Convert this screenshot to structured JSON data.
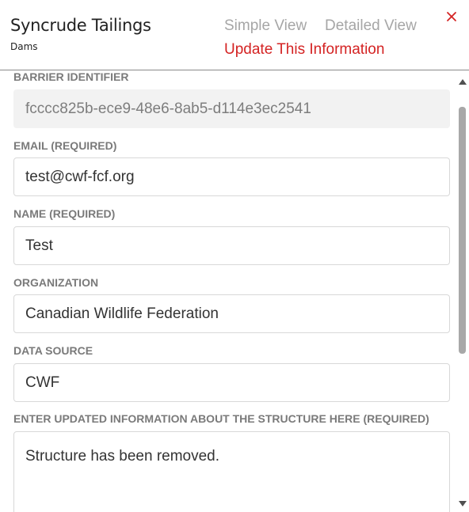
{
  "header": {
    "title": "Syncrude Tailings",
    "subtitle": "Dams",
    "simple_view_label": "Simple View",
    "detailed_view_label": "Detailed View",
    "update_label": "Update This Information",
    "close_icon": "close-icon"
  },
  "colors": {
    "accent_red": "#d42323",
    "muted_gray": "#a6a6a6",
    "label_gray": "#7a7a7a",
    "readonly_bg": "#f2f2f2"
  },
  "form": {
    "barrier_identifier": {
      "label": "BARRIER IDENTIFIER",
      "value": "fcccc825b-ece9-48e6-8ab5-d114e3ec2541"
    },
    "email": {
      "label": "EMAIL (REQUIRED)",
      "value": "test@cwf-fcf.org"
    },
    "name": {
      "label": "NAME (REQUIRED)",
      "value": "Test"
    },
    "organization": {
      "label": "ORGANIZATION",
      "value": "Canadian Wildlife Federation"
    },
    "data_source": {
      "label": "DATA SOURCE",
      "value": "CWF"
    },
    "updated_info": {
      "label": "ENTER UPDATED INFORMATION ABOUT THE STRUCTURE HERE (REQUIRED)",
      "value": "Structure has been removed."
    }
  }
}
